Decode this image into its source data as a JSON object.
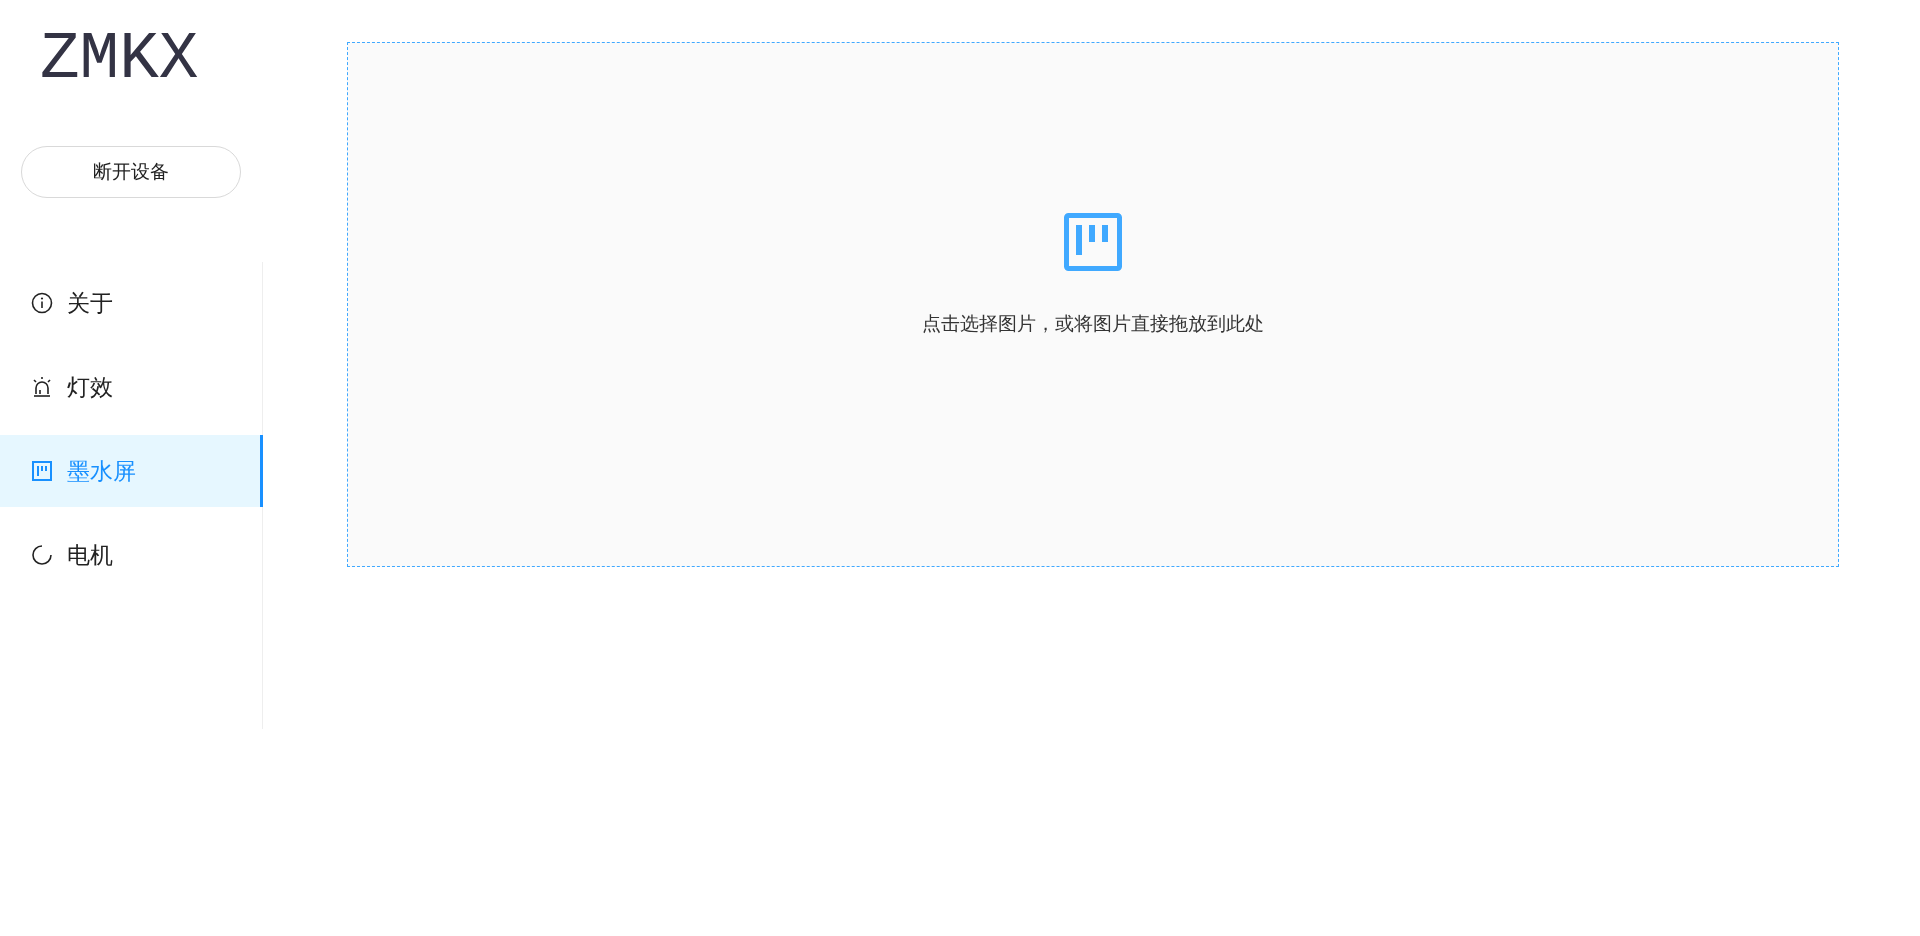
{
  "logo": "ZMKX",
  "disconnect_button": "断开设备",
  "menu": [
    {
      "label": "关于",
      "kind": "info",
      "selected": false
    },
    {
      "label": "灯效",
      "kind": "light",
      "selected": false
    },
    {
      "label": "墨水屏",
      "kind": "screen",
      "selected": true
    },
    {
      "label": "电机",
      "kind": "motor",
      "selected": false
    }
  ],
  "upload": {
    "hint": "点击选择图片，或将图片直接拖放到此处"
  }
}
